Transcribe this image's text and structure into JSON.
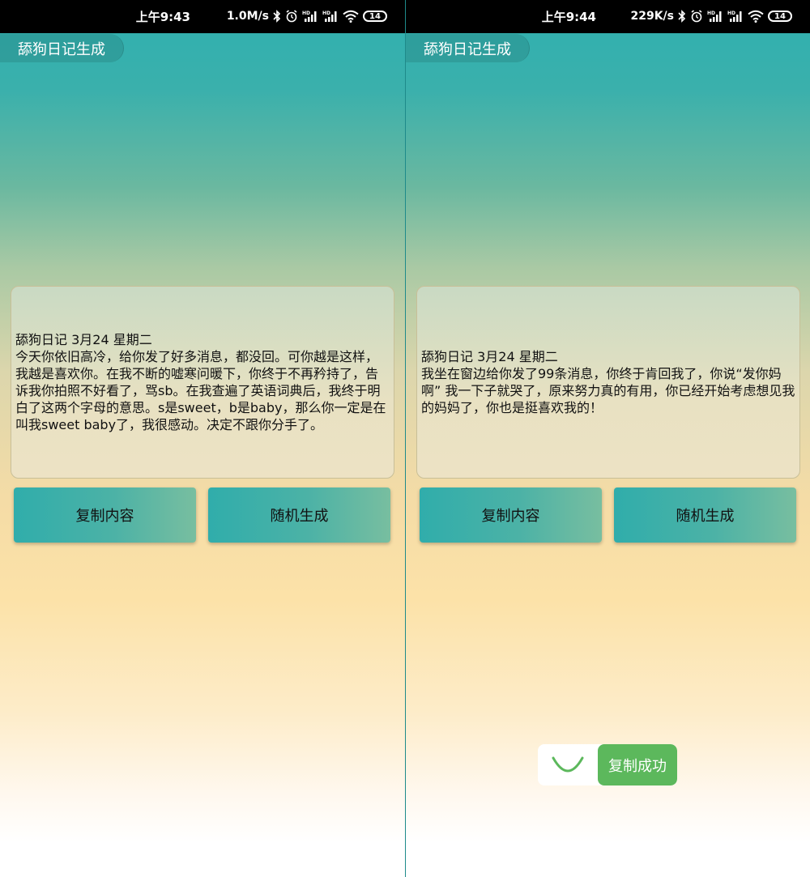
{
  "app": {
    "title": "舔狗日记生成"
  },
  "buttons": {
    "copy_label": "复制内容",
    "random_label": "随机生成"
  },
  "screens": [
    {
      "status": {
        "time": "上午9:43",
        "net_speed": "1.0M/s",
        "battery": "14"
      },
      "diary": {
        "header": "舔狗日记 3月24 星期二",
        "body": "今天你依旧高冷，给你发了好多消息，都没回。可你越是这样，我越是喜欢你。在我不断的嘘寒问暖下，你终于不再矜持了，告诉我你拍照不好看了，骂sb。在我查遍了英语词典后，我终于明白了这两个字母的意思。s是sweet，b是baby，那么你一定是在叫我sweet baby了，我很感动。决定不跟你分手了。"
      }
    },
    {
      "status": {
        "time": "上午9:44",
        "net_speed": "229K/s",
        "battery": "14"
      },
      "diary": {
        "header": "舔狗日记 3月24 星期二",
        "body": "我坐在窗边给你发了99条消息，你终于肯回我了，你说“发你妈啊” 我一下子就哭了，原来努力真的有用，你已经开始考虑想见我的妈妈了，你也是挺喜欢我的！"
      },
      "toast": {
        "message": "复制成功"
      }
    }
  ],
  "colors": {
    "accent": "#30adab",
    "toast_success": "#5cb85c"
  },
  "icons": [
    "bluetooth-icon",
    "alarm-icon",
    "hd-signal-icon",
    "wifi-icon",
    "battery-icon",
    "loading-spinner-icon"
  ]
}
